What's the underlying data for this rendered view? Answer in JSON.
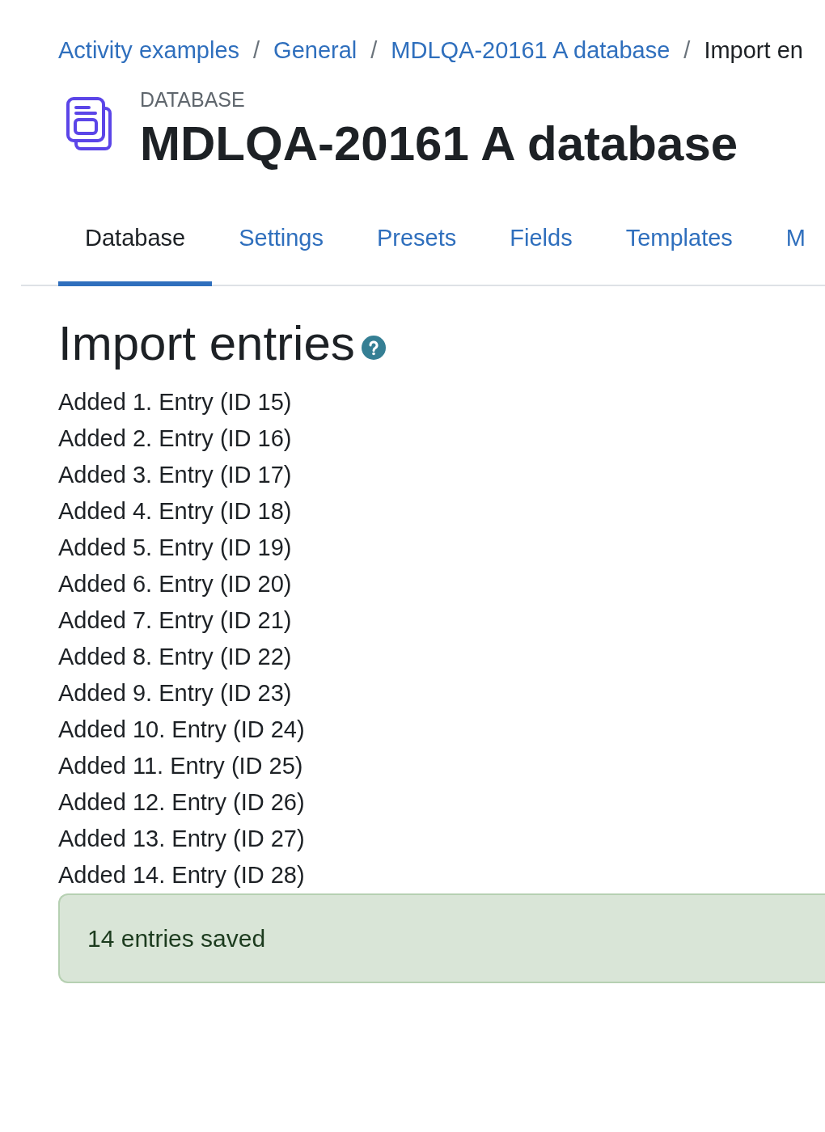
{
  "breadcrumb": {
    "separator": "/",
    "items": [
      {
        "label": "Activity examples",
        "current": false
      },
      {
        "label": "General",
        "current": false
      },
      {
        "label": "MDLQA-20161 A database",
        "current": false
      },
      {
        "label": "Import en",
        "current": true
      }
    ]
  },
  "header": {
    "kind_label": "DATABASE",
    "title": "MDLQA-20161 A database"
  },
  "tabs": [
    {
      "label": "Database",
      "selected": true
    },
    {
      "label": "Settings",
      "selected": false
    },
    {
      "label": "Presets",
      "selected": false
    },
    {
      "label": "Fields",
      "selected": false
    },
    {
      "label": "Templates",
      "selected": false
    },
    {
      "label": "M",
      "selected": false
    }
  ],
  "heading": "Import entries",
  "entries": [
    "Added 1. Entry (ID 15)",
    "Added 2. Entry (ID 16)",
    "Added 3. Entry (ID 17)",
    "Added 4. Entry (ID 18)",
    "Added 5. Entry (ID 19)",
    "Added 6. Entry (ID 20)",
    "Added 7. Entry (ID 21)",
    "Added 8. Entry (ID 22)",
    "Added 9. Entry (ID 23)",
    "Added 10. Entry (ID 24)",
    "Added 11. Entry (ID 25)",
    "Added 12. Entry (ID 26)",
    "Added 13. Entry (ID 27)",
    "Added 14. Entry (ID 28)"
  ],
  "alert": {
    "message": "14 entries saved"
  }
}
